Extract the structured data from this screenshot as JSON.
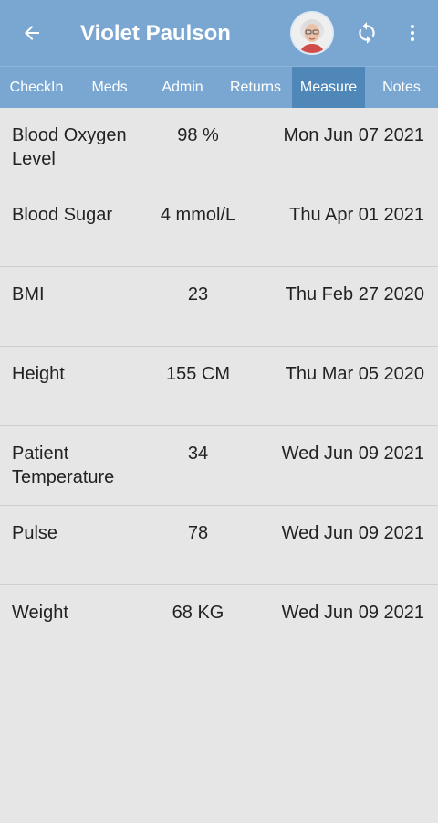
{
  "header": {
    "title": "Violet Paulson",
    "back_icon": "arrow-left-icon",
    "refresh_icon": "refresh-icon",
    "menu_icon": "more-vert-icon",
    "background_color": "#7aa7d1"
  },
  "tabs": [
    {
      "label": "CheckIn"
    },
    {
      "label": "Meds"
    },
    {
      "label": "Admin"
    },
    {
      "label": "Returns"
    },
    {
      "label": "Measure",
      "active": true
    },
    {
      "label": "Notes"
    }
  ],
  "active_tab_color": "#4f88b8",
  "measurements": [
    {
      "name": "Blood Oxygen Level",
      "value": "98 %",
      "date": "Mon Jun 07 2021"
    },
    {
      "name": "Blood Sugar",
      "value": "4 mmol/L",
      "date": "Thu Apr 01 2021"
    },
    {
      "name": "BMI",
      "value": "23",
      "date": "Thu Feb 27 2020"
    },
    {
      "name": "Height",
      "value": "155 CM",
      "date": "Thu Mar 05 2020"
    },
    {
      "name": "Patient Temperature",
      "value": "34",
      "date": "Wed Jun 09 2021"
    },
    {
      "name": "Pulse",
      "value": "78",
      "date": "Wed Jun 09 2021"
    },
    {
      "name": "Weight",
      "value": "68 KG",
      "date": "Wed Jun 09 2021"
    }
  ]
}
